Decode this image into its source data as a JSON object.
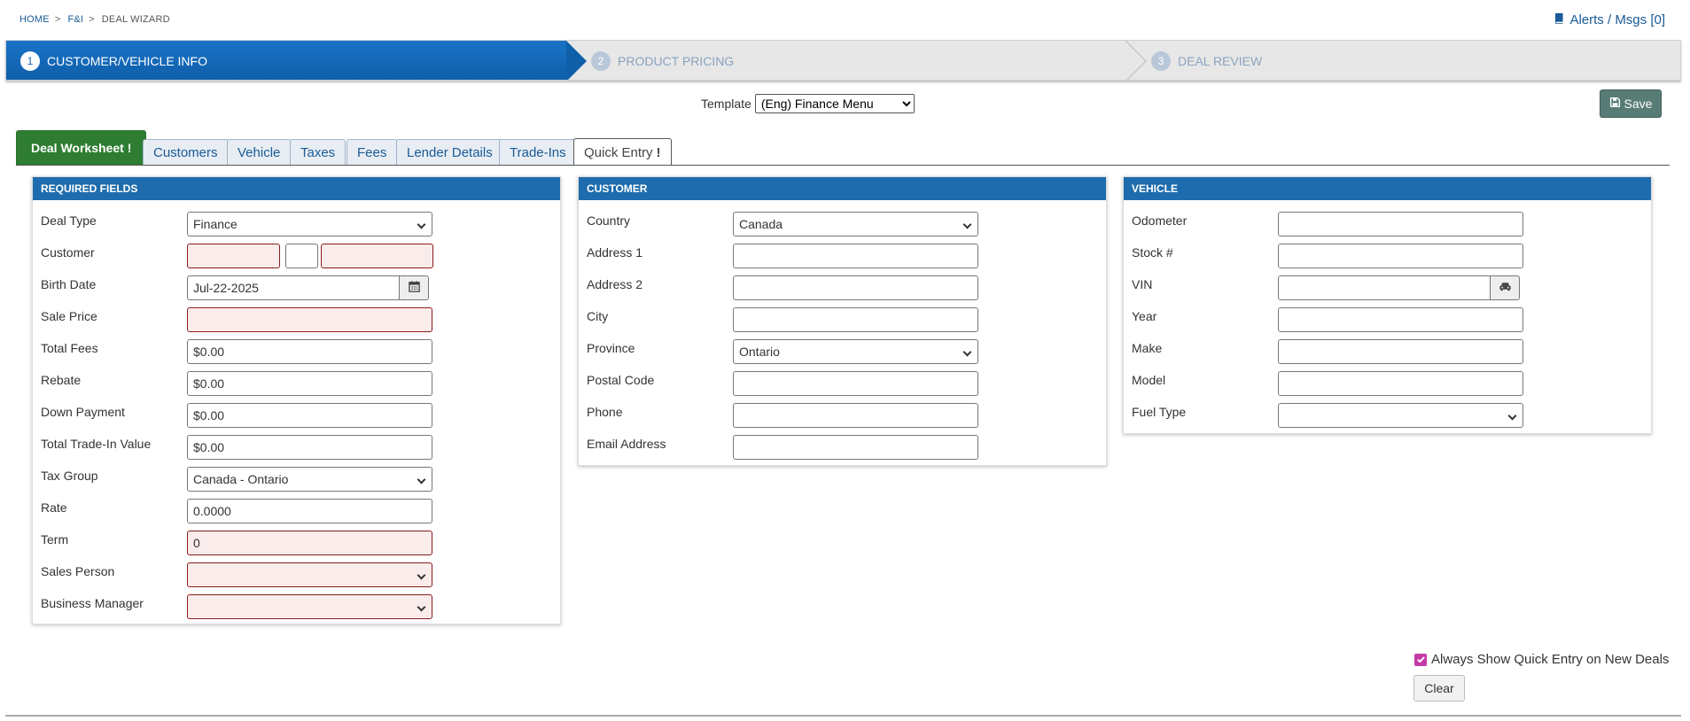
{
  "breadcrumb": {
    "home": "HOME",
    "fi": "F&I",
    "current": "DEAL WIZARD",
    "sep": ">"
  },
  "alerts": {
    "label": "Alerts / Msgs [0]"
  },
  "wizard": {
    "steps": [
      {
        "num": "1",
        "label": "CUSTOMER/VEHICLE INFO"
      },
      {
        "num": "2",
        "label": "PRODUCT PRICING"
      },
      {
        "num": "3",
        "label": "DEAL REVIEW"
      }
    ]
  },
  "template": {
    "label": "Template",
    "selected": "(Eng) Finance Menu"
  },
  "save": {
    "label": "Save"
  },
  "tabs": [
    {
      "label": "Deal Worksheet"
    },
    {
      "label": "Customers"
    },
    {
      "label": "Vehicle"
    },
    {
      "label": "Taxes"
    },
    {
      "label": "Fees"
    },
    {
      "label": "Lender Details"
    },
    {
      "label": "Trade-Ins"
    },
    {
      "label": "Quick Entry"
    }
  ],
  "tab_flag": "!",
  "required": {
    "title": "REQUIRED FIELDS",
    "deal_type": {
      "label": "Deal Type",
      "value": "Finance"
    },
    "customer": {
      "label": "Customer"
    },
    "birth_date": {
      "label": "Birth Date",
      "value": "Jul-22-2025"
    },
    "sale_price": {
      "label": "Sale Price"
    },
    "total_fees": {
      "label": "Total Fees",
      "value": "$0.00"
    },
    "rebate": {
      "label": "Rebate",
      "value": "$0.00"
    },
    "down_payment": {
      "label": "Down Payment",
      "value": "$0.00"
    },
    "trade_in": {
      "label": "Total Trade-In Value",
      "value": "$0.00"
    },
    "tax_group": {
      "label": "Tax Group",
      "value": "Canada - Ontario"
    },
    "rate": {
      "label": "Rate",
      "value": "0.0000"
    },
    "term": {
      "label": "Term",
      "value": "0"
    },
    "sales_person": {
      "label": "Sales Person"
    },
    "business_manager": {
      "label": "Business Manager"
    }
  },
  "customer": {
    "title": "CUSTOMER",
    "country": {
      "label": "Country",
      "value": "Canada"
    },
    "address1": {
      "label": "Address 1"
    },
    "address2": {
      "label": "Address 2"
    },
    "city": {
      "label": "City"
    },
    "province": {
      "label": "Province",
      "value": "Ontario"
    },
    "postal": {
      "label": "Postal Code"
    },
    "phone": {
      "label": "Phone"
    },
    "email": {
      "label": "Email Address"
    }
  },
  "vehicle": {
    "title": "VEHICLE",
    "odometer": {
      "label": "Odometer"
    },
    "stock": {
      "label": "Stock #"
    },
    "vin": {
      "label": "VIN"
    },
    "year": {
      "label": "Year"
    },
    "make": {
      "label": "Make"
    },
    "model": {
      "label": "Model"
    },
    "fuel": {
      "label": "Fuel Type"
    }
  },
  "footer": {
    "always_show": "Always Show Quick Entry on New Deals",
    "always_show_checked": true,
    "clear": "Clear"
  },
  "colors": {
    "primary": "#1565b5",
    "panel_header": "#1e6cad",
    "worksheet_tab": "#2e7d32",
    "save": "#577c76",
    "required_border": "#8b1a1a",
    "checkbox": "#c43aa5"
  }
}
